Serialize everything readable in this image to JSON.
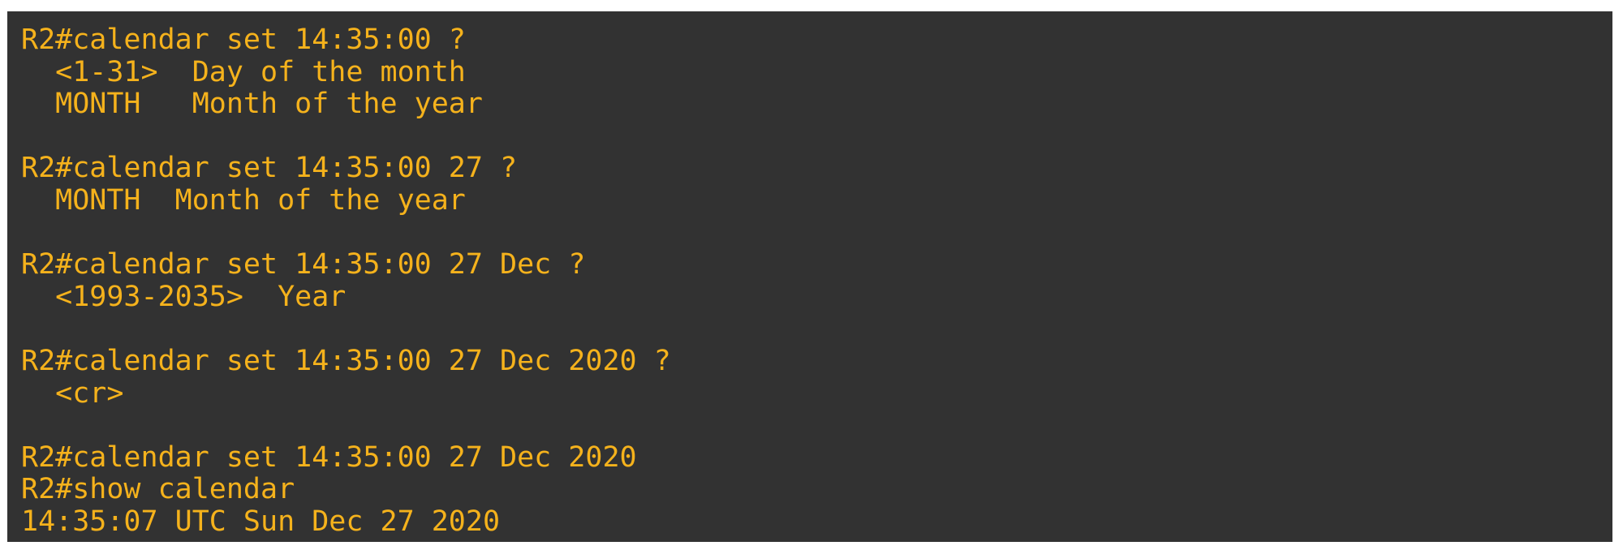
{
  "terminal": {
    "lines": [
      "R2#calendar set 14:35:00 ?",
      "  <1-31>  Day of the month",
      "  MONTH   Month of the year",
      "",
      "R2#calendar set 14:35:00 27 ?",
      "  MONTH  Month of the year",
      "",
      "R2#calendar set 14:35:00 27 Dec ?",
      "  <1993-2035>  Year",
      "",
      "R2#calendar set 14:35:00 27 Dec 2020 ?",
      "  <cr>",
      "",
      "R2#calendar set 14:35:00 27 Dec 2020",
      "R2#show calendar",
      "14:35:07 UTC Sun Dec 27 2020"
    ],
    "colors": {
      "background": "#323232",
      "text": "#f5b21c"
    }
  }
}
